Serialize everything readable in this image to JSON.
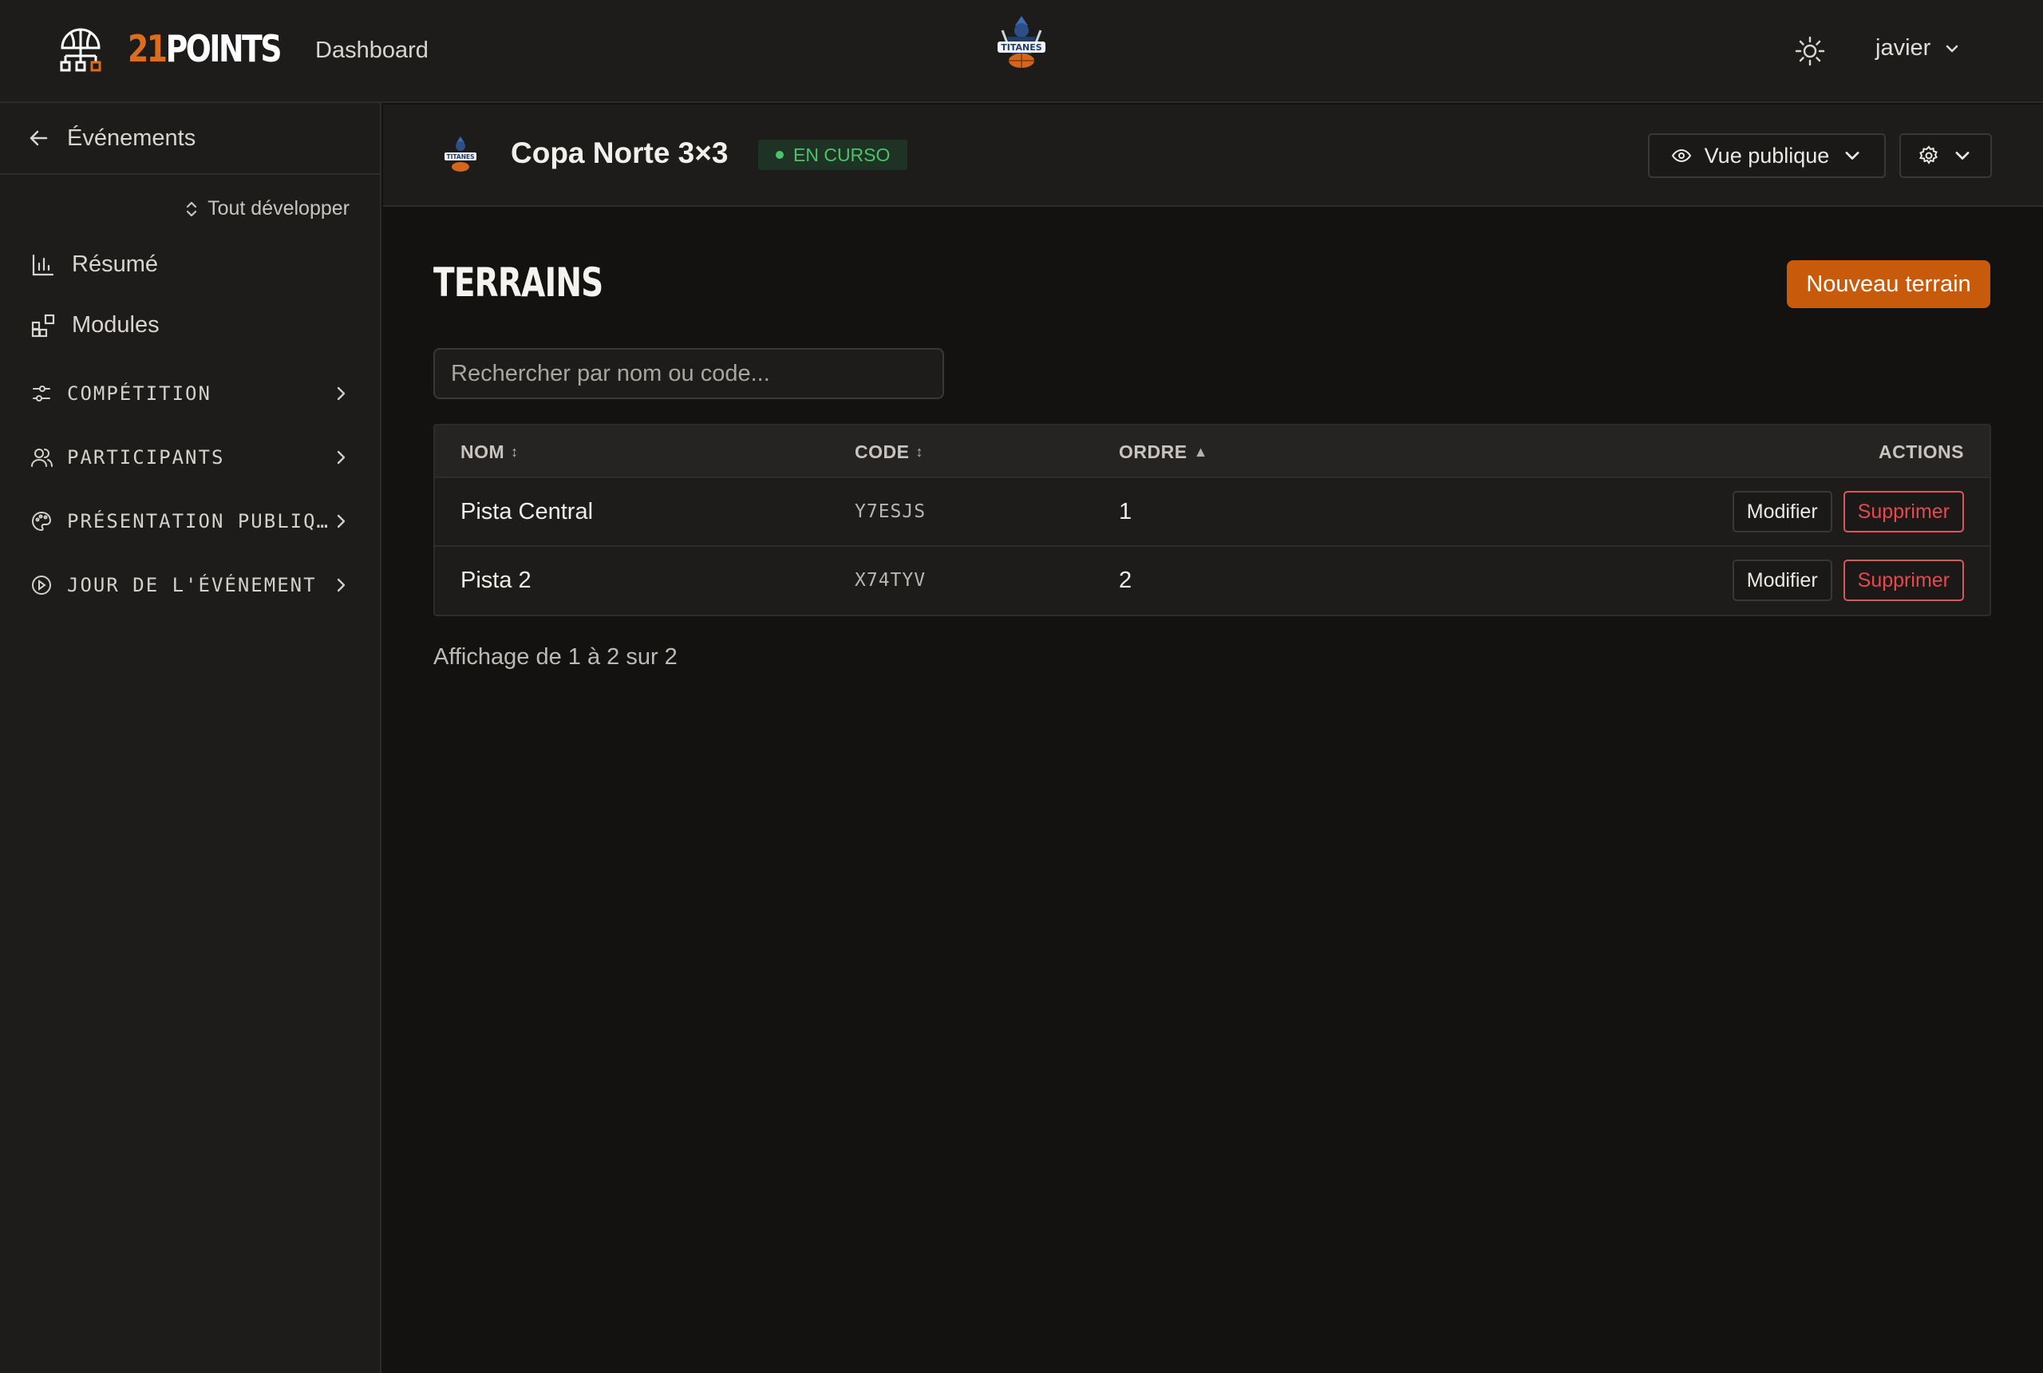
{
  "topbar": {
    "brand_number": "21",
    "brand_word": "POINTS",
    "nav_dashboard": "Dashboard",
    "center_logo_icon": "titanes-team-logo",
    "theme_icon": "sun-icon",
    "user_name": "javier"
  },
  "sidebar": {
    "back_label": "Événements",
    "expand_all": "Tout développer",
    "items": [
      {
        "label": "Résumé",
        "icon": "bar-chart-icon"
      },
      {
        "label": "Modules",
        "icon": "grid-icon"
      }
    ],
    "groups": [
      {
        "label": "COMPÉTITION",
        "icon": "sliders-icon"
      },
      {
        "label": "PARTICIPANTS",
        "icon": "users-icon"
      },
      {
        "label": "PRÉSENTATION PUBLIQ…",
        "icon": "palette-icon"
      },
      {
        "label": "JOUR DE L'ÉVÉNEMENT",
        "icon": "play-circle-icon"
      }
    ]
  },
  "event": {
    "title": "Copa Norte 3×3",
    "status": "EN CURSO",
    "public_view": "Vue publique"
  },
  "main": {
    "title": "TERRAINS",
    "new_button": "Nouveau terrain",
    "search_placeholder": "Rechercher par nom ou code...",
    "table": {
      "columns": {
        "name": "NOM",
        "code": "CODE",
        "order": "ORDRE",
        "actions": "ACTIONS"
      },
      "sort_icons": {
        "name": "↕",
        "code": "↕",
        "order": "▲"
      },
      "rows": [
        {
          "name": "Pista Central",
          "code": "Y7ESJS",
          "order": "1",
          "edit": "Modifier",
          "delete": "Supprimer"
        },
        {
          "name": "Pista 2",
          "code": "X74TYV",
          "order": "2",
          "edit": "Modifier",
          "delete": "Supprimer"
        }
      ]
    },
    "pagination": "Affichage de 1 à 2 sur 2"
  },
  "colors": {
    "accent": "#c85a0c",
    "brand_orange": "#dc6d1c",
    "status_green": "#4cc26c",
    "danger": "#e24a4f"
  }
}
